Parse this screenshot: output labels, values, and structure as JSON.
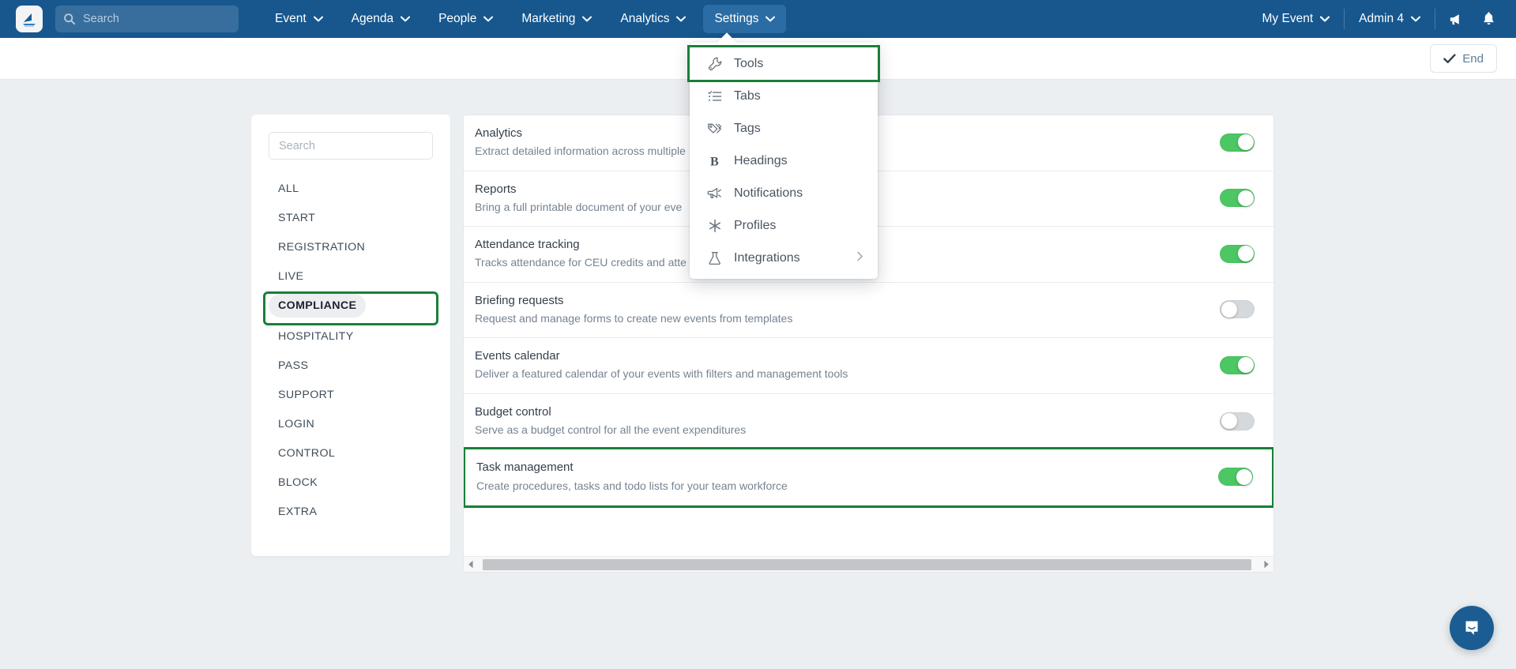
{
  "topnav": {
    "logo_alt": "app-logo",
    "search": {
      "value": "",
      "placeholder": "Search"
    },
    "items": [
      {
        "label": "Event",
        "has_chevron": true,
        "active": false
      },
      {
        "label": "Agenda",
        "has_chevron": true,
        "active": false
      },
      {
        "label": "People",
        "has_chevron": true,
        "active": false
      },
      {
        "label": "Marketing",
        "has_chevron": true,
        "active": false
      },
      {
        "label": "Analytics",
        "has_chevron": true,
        "active": false
      },
      {
        "label": "Settings",
        "has_chevron": true,
        "active": true
      }
    ],
    "right_items": [
      {
        "label": "My Event",
        "has_chevron": true
      },
      {
        "label": "Admin 4",
        "has_chevron": true
      }
    ],
    "announcement_icon": "megaphone-icon",
    "notification_icon": "bell-icon",
    "bg_color": "#17578e",
    "active_bg_color": "#2a6ca3"
  },
  "subheader": {
    "end_button": {
      "label": "End",
      "icon": "check-icon"
    }
  },
  "settings_menu": {
    "items": [
      {
        "label": "Tools",
        "icon": "wrench-icon",
        "highlighted": true,
        "has_submenu": false
      },
      {
        "label": "Tabs",
        "icon": "list-check-icon",
        "highlighted": false,
        "has_submenu": false
      },
      {
        "label": "Tags",
        "icon": "tags-icon",
        "highlighted": false,
        "has_submenu": false
      },
      {
        "label": "Headings",
        "icon": "bold-b-icon",
        "highlighted": false,
        "has_submenu": false
      },
      {
        "label": "Notifications",
        "icon": "megaphone-icon",
        "highlighted": false,
        "has_submenu": false
      },
      {
        "label": "Profiles",
        "icon": "asterisk-icon",
        "highlighted": false,
        "has_submenu": false
      },
      {
        "label": "Integrations",
        "icon": "flask-icon",
        "highlighted": false,
        "has_submenu": true
      }
    ],
    "highlight_color": "#198038"
  },
  "sidebar": {
    "search": {
      "value": "",
      "placeholder": "Search"
    },
    "items": [
      {
        "label": "ALL",
        "selected": false,
        "highlighted": false
      },
      {
        "label": "START",
        "selected": false,
        "highlighted": false
      },
      {
        "label": "REGISTRATION",
        "selected": false,
        "highlighted": false
      },
      {
        "label": "LIVE",
        "selected": false,
        "highlighted": false
      },
      {
        "label": "COMPLIANCE",
        "selected": true,
        "highlighted": true
      },
      {
        "label": "HOSPITALITY",
        "selected": false,
        "highlighted": false
      },
      {
        "label": "PASS",
        "selected": false,
        "highlighted": false
      },
      {
        "label": "SUPPORT",
        "selected": false,
        "highlighted": false
      },
      {
        "label": "LOGIN",
        "selected": false,
        "highlighted": false
      },
      {
        "label": "CONTROL",
        "selected": false,
        "highlighted": false
      },
      {
        "label": "BLOCK",
        "selected": false,
        "highlighted": false
      },
      {
        "label": "EXTRA",
        "selected": false,
        "highlighted": false
      }
    ]
  },
  "tools_list": {
    "rows": [
      {
        "title": "Analytics",
        "description": "Extract detailed information across multiple",
        "enabled": true,
        "highlighted": false
      },
      {
        "title": "Reports",
        "description": "Bring a full printable document of your eve",
        "enabled": true,
        "highlighted": false
      },
      {
        "title": "Attendance tracking",
        "description": "Tracks attendance for CEU credits and atte",
        "enabled": true,
        "highlighted": false
      },
      {
        "title": "Briefing requests",
        "description": "Request and manage forms to create new events from templates",
        "enabled": false,
        "highlighted": false
      },
      {
        "title": "Events calendar",
        "description": "Deliver a featured calendar of your events with filters and management tools",
        "enabled": true,
        "highlighted": false
      },
      {
        "title": "Budget control",
        "description": "Serve as a budget control for all the event expenditures",
        "enabled": false,
        "highlighted": false
      },
      {
        "title": "Task management",
        "description": "Create procedures, tasks and todo lists for your team workforce",
        "enabled": true,
        "highlighted": true
      }
    ],
    "toggle_on_color": "#4cc764",
    "toggle_off_color": "#d6d9dc"
  },
  "chat_widget": {
    "icon": "intercom-chat-icon",
    "color": "#1b5d92"
  }
}
